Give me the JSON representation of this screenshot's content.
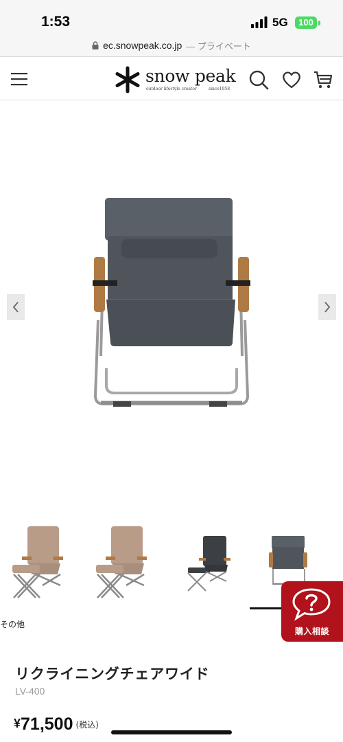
{
  "status_bar": {
    "time": "1:53",
    "network": "5G",
    "battery": "100"
  },
  "browser": {
    "url": "ec.snowpeak.co.jp",
    "privacy_label": "— プライベート"
  },
  "header": {
    "brand_name": "snow peak",
    "brand_tagline": "outdoor lifestyle creator",
    "brand_since": "since1958",
    "icons": [
      "menu-icon",
      "search-icon",
      "heart-icon",
      "cart-icon"
    ]
  },
  "gallery": {
    "prev_icon": "chevron-left-icon",
    "next_icon": "chevron-right-icon",
    "thumbnail_count": 4,
    "active_thumbnail": 4,
    "thumbnail_caption": "その他"
  },
  "consult_button": {
    "label": "購入相談",
    "icon": "question-bubble-icon"
  },
  "product": {
    "name": "リクライニングチェアワイド",
    "code": "LV-400",
    "currency": "¥",
    "price": "71,500",
    "tax_note": "(税込)"
  },
  "colors": {
    "accent_red": "#b1121b",
    "battery_green": "#4cd964",
    "fabric_gray": "#4f555b",
    "wood_arm": "#b07a45"
  }
}
